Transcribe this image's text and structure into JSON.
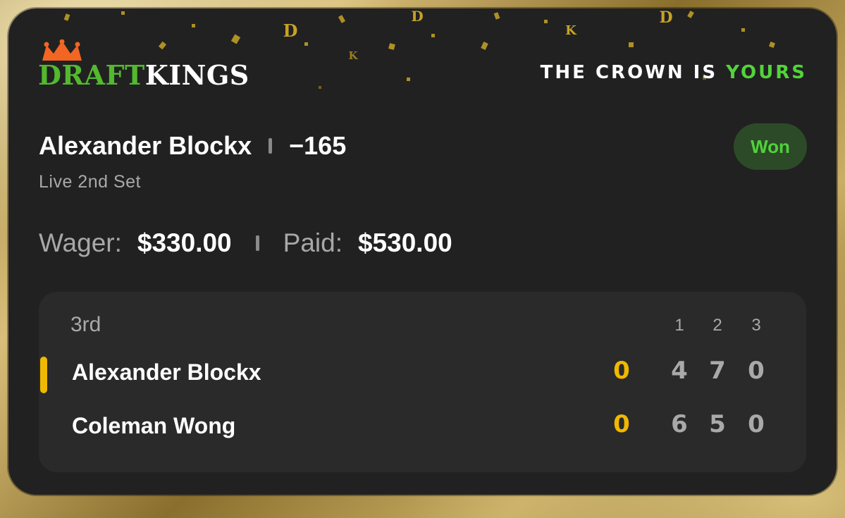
{
  "brand": {
    "logo_initial": "D",
    "logo_rest_green": "RAFT",
    "logo_white": "KINGS",
    "tagline_prefix": "THE CROWN IS ",
    "tagline_accent": "YOURS",
    "colors": {
      "accent_green": "#53b92e",
      "logo_crown": "#f26522",
      "highlight_yellow": "#f0b800"
    }
  },
  "bet": {
    "selection": "Alexander Blockx",
    "odds": "−165",
    "status": "Won",
    "market": "Live 2nd Set"
  },
  "wager": {
    "wager_label": "Wager:",
    "wager_value": "$330.00",
    "paid_label": "Paid:",
    "paid_value": "$530.00"
  },
  "scoreboard": {
    "period": "3rd",
    "set_headers": [
      "1",
      "2",
      "3"
    ],
    "players": [
      {
        "name": "Alexander Blockx",
        "current": "0",
        "sets": [
          "4",
          "7",
          "0"
        ],
        "serving": true
      },
      {
        "name": "Coleman Wong",
        "current": "0",
        "sets": [
          "6",
          "5",
          "0"
        ],
        "serving": false
      }
    ]
  }
}
